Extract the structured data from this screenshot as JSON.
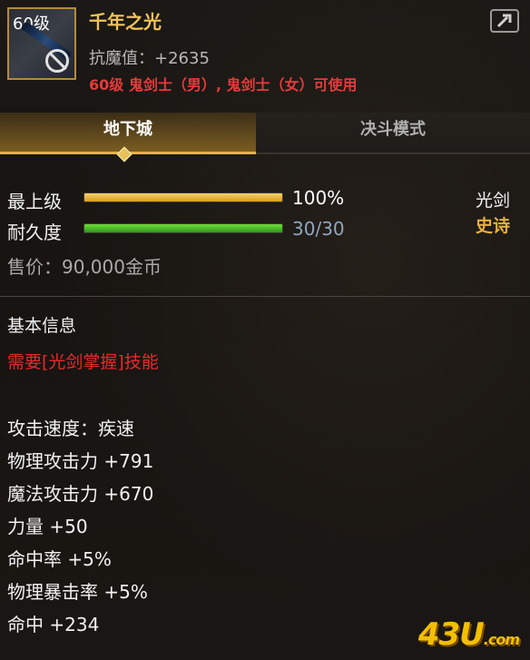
{
  "item": {
    "level_badge": "60级",
    "name": "千年之光",
    "resist": "抗魔值：+2635",
    "requirement": "60级 鬼剑士（男）, 鬼剑士（女）可使用"
  },
  "tabs": [
    {
      "label": "地下城",
      "active": true
    },
    {
      "label": "决斗模式",
      "active": false
    }
  ],
  "stats": {
    "grade_label": "最上级",
    "grade_value": "100%",
    "grade_fraction": 1.0,
    "durability_label": "耐久度",
    "durability_value": "30/30",
    "durability_fraction": 1.0,
    "weapon_type": "光剑",
    "rarity": "史诗",
    "price": "售价：90,000金币"
  },
  "basic_info": {
    "title": "基本信息",
    "skill_requirement": "需要[光剑掌握]技能",
    "attributes": [
      "攻击速度：疾速",
      "物理攻击力 +791",
      "魔法攻击力 +670",
      "力量 +50",
      "命中率 +5%",
      "物理暴击率 +5%",
      "命中 +234"
    ]
  },
  "watermark": {
    "main": "43U",
    "suffix": ".com"
  },
  "colors": {
    "item_name": "#f0c35a",
    "requirement": "#e43b3b",
    "rarity": "#e6b03c",
    "grade_bar": "#e6ad2f",
    "durability_bar": "#3fbf24"
  }
}
